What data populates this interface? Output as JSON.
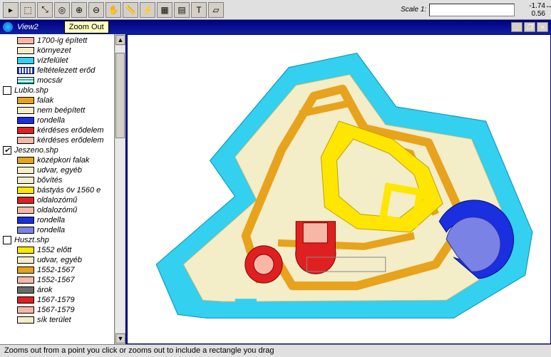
{
  "coords": {
    "x": "-1.74",
    "y": "0.56"
  },
  "scale": {
    "label": "Scale 1:",
    "value": ""
  },
  "view": {
    "title": "View2",
    "tooltip": "Zoom Out"
  },
  "statusbar": "Zooms out from a point you click or zooms out to include a rectangle you drag",
  "toolbar": {
    "icons": [
      "pointer",
      "select",
      "vertex",
      "identify",
      "zoom-in",
      "zoom-out",
      "pan",
      "measure",
      "flash",
      "grid",
      "properties",
      "text",
      "area"
    ]
  },
  "groups": [
    {
      "name": "",
      "checked": null,
      "items": [
        {
          "label": "1700-ig épített",
          "color": "#f7b7a6"
        },
        {
          "label": "környezet",
          "color": "#f3edc8"
        },
        {
          "label": "vízfelület",
          "color": "#33d0ef"
        },
        {
          "label": "feltételezett erőd",
          "hatch": "v"
        },
        {
          "label": "mocsár",
          "hatch": "h"
        }
      ]
    },
    {
      "name": "Lublo.shp",
      "checked": false,
      "items": [
        {
          "label": "falak",
          "color": "#e7a31c"
        },
        {
          "label": "nem beépített",
          "color": "#f3edc8"
        },
        {
          "label": "rondella",
          "color": "#1a2fe0"
        },
        {
          "label": "kérdéses erődelem",
          "color": "#e02020"
        },
        {
          "label": "kérdéses erődelem",
          "color": "#f7b7a6"
        }
      ]
    },
    {
      "name": "Jeszeno.shp",
      "checked": true,
      "items": [
        {
          "label": "középkori falak",
          "color": "#e7a31c"
        },
        {
          "label": "udvar, egyéb",
          "color": "#f3edc8"
        },
        {
          "label": "bővítés",
          "color": "#f3edc8"
        },
        {
          "label": "bástyás öv 1560 e",
          "color": "#ffe600"
        },
        {
          "label": "oldalozómű",
          "color": "#e02020"
        },
        {
          "label": "oldalozómű",
          "color": "#f7b7a6"
        },
        {
          "label": "rondella",
          "color": "#1a2fe0"
        },
        {
          "label": "rondella",
          "color": "#7a82e6"
        }
      ]
    },
    {
      "name": "Huszt.shp",
      "checked": false,
      "items": [
        {
          "label": "1552 előtt",
          "color": "#ffe600"
        },
        {
          "label": "udvar, egyéb",
          "color": "#f3edc8"
        },
        {
          "label": "1552-1567",
          "color": "#e7a31c"
        },
        {
          "label": "1552-1567",
          "color": "#f7b7a6"
        },
        {
          "label": "árok",
          "color": "#6b6b6b"
        },
        {
          "label": "1567-1579",
          "color": "#e02020"
        },
        {
          "label": "1567-1579",
          "color": "#f7b7a6"
        },
        {
          "label": "sík terület",
          "color": "#f3edc8"
        }
      ]
    }
  ],
  "win_btns": {
    "min": "_",
    "max": "❐",
    "close": "×"
  }
}
